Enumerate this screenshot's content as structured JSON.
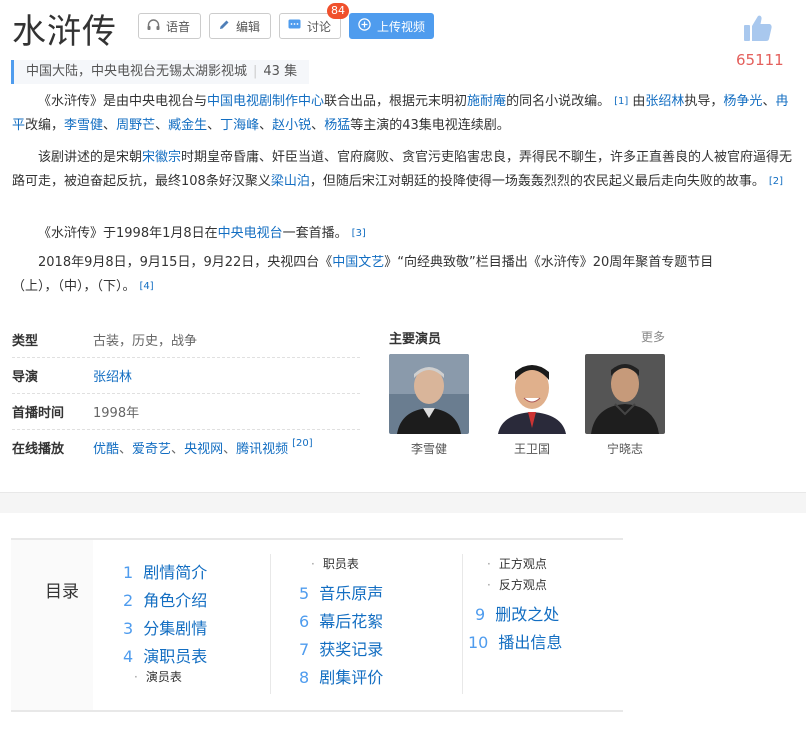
{
  "header": {
    "title": "水浒传",
    "buttons": {
      "voice": "语音",
      "edit": "编辑",
      "discuss": "讨论",
      "upload": "上传视频"
    },
    "discuss_count": "84",
    "likes": "65111"
  },
  "subtitle": {
    "info": "中国大陆，中央电视台无锡太湖影视城",
    "episodes": "43 集"
  },
  "intro": {
    "p1": {
      "t1": "《水浒传》是由中央电视台与",
      "l1": "中国电视剧制作中心",
      "t2": "联合出品，根据元末明初",
      "l2": "施耐庵",
      "t3": "的同名小说改编。",
      "ref1": "[1]",
      "t4": " 由",
      "l3": "张绍林",
      "t5": "执导，",
      "l4": "杨争光",
      "s1": "、",
      "l5": "冉平",
      "t6": "改编，",
      "l6": "李雪健",
      "s2": "、",
      "l7": "周野芒",
      "s3": "、",
      "l8": "臧金生",
      "s4": "、",
      "l9": "丁海峰",
      "s5": "、",
      "l10": "赵小锐",
      "s6": "、",
      "l11": "杨猛",
      "t7": "等主演的43集电视连续剧。"
    },
    "p2": {
      "t1": "该剧讲述的是宋朝",
      "l1": "宋徽宗",
      "t2": "时期皇帝昏庸、奸臣当道、官府腐败、贪官污吏陷害忠良，弄得民不聊生，许多正直善良的人被官府逼得无路可走，被迫奋起反抗，最终108条好汉聚义",
      "l2": "梁山泊",
      "t3": "，但随后宋江对朝廷的投降使得一场轰轰烈烈的农民起义最后走向失败的故事。",
      "ref": "[2]"
    },
    "p3": {
      "t1": "《水浒传》于1998年1月8日在",
      "l1": "中央电视台",
      "t2": "一套首播。",
      "ref": "[3]"
    },
    "p4": {
      "t1": "2018年9月8日，9月15日，9月22日，央视四台《",
      "l1": "中国文艺",
      "t2": "》“向经典致敬”栏目播出《水浒传》20周年聚首专题节目（上），（中），（下）。",
      "ref": "[4]"
    }
  },
  "info": {
    "type_label": "类型",
    "type_value": "古装，历史，战争",
    "director_label": "导演",
    "director_value": "张绍林",
    "premiere_label": "首播时间",
    "premiere_value": "1998年",
    "online_label": "在线播放",
    "online": [
      "优酷",
      "爱奇艺",
      "央视网",
      "腾讯视频"
    ],
    "online_sep": "、",
    "online_ref": "[20]"
  },
  "actors": {
    "title": "主要演员",
    "more": "更多",
    "list": [
      {
        "name": "李雪健"
      },
      {
        "name": "王卫国"
      },
      {
        "name": "宁晓志"
      }
    ]
  },
  "toc": {
    "title": "目录",
    "items": [
      {
        "num": "1",
        "label": "剧情简介"
      },
      {
        "num": "2",
        "label": "角色介绍"
      },
      {
        "num": "3",
        "label": "分集剧情"
      },
      {
        "num": "4",
        "label": "演职员表"
      },
      {
        "num": "5",
        "label": "音乐原声"
      },
      {
        "num": "6",
        "label": "幕后花絮"
      },
      {
        "num": "7",
        "label": "获奖记录"
      },
      {
        "num": "8",
        "label": "剧集评价"
      },
      {
        "num": "9",
        "label": "删改之处"
      },
      {
        "num": "10",
        "label": "播出信息"
      }
    ],
    "subs": [
      "演员表",
      "职员表",
      "正方观点",
      "反方观点"
    ],
    "sub_dot": "·"
  },
  "colors": {
    "link": "#136ec2",
    "accent": "#4f9cee",
    "likes": "#e4605c",
    "badge": "#f0502c"
  }
}
